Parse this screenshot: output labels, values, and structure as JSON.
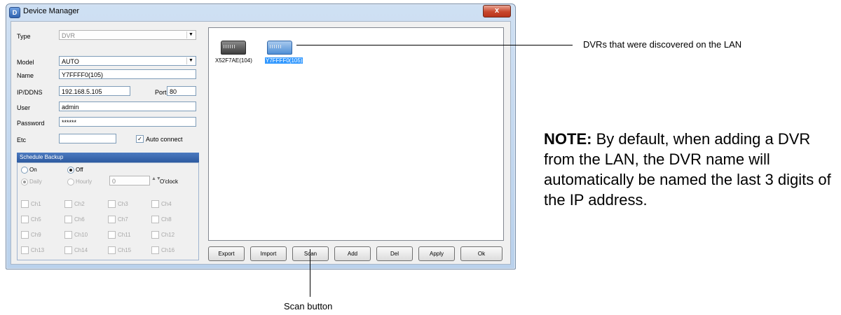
{
  "window": {
    "title": "Device Manager",
    "close_glyph": "x"
  },
  "form": {
    "type_label": "Type",
    "type_value": "DVR",
    "model_label": "Model",
    "model_value": "AUTO",
    "name_label": "Name",
    "name_value": "Y7FFFF0(105)",
    "ip_label": "IP/DDNS",
    "ip_value": "192.168.5.105",
    "port_label": "Port",
    "port_value": "80",
    "user_label": "User",
    "user_value": "admin",
    "password_label": "Password",
    "password_value": "******",
    "etc_label": "Etc",
    "etc_value": "",
    "auto_connect_label": "Auto connect",
    "auto_connect_checked": true
  },
  "schedule": {
    "header": "Schedule Backup",
    "on_label": "On",
    "off_label": "Off",
    "selected": "Off",
    "daily_label": "Daily",
    "hourly_label": "Hourly",
    "hour_value": "0",
    "oclock_label": "O'clock",
    "channels": [
      "Ch1",
      "Ch2",
      "Ch3",
      "Ch4",
      "Ch5",
      "Ch6",
      "Ch7",
      "Ch8",
      "Ch9",
      "Ch10",
      "Ch11",
      "Ch12",
      "Ch13",
      "Ch14",
      "Ch15",
      "Ch16"
    ]
  },
  "devices": [
    {
      "name": "X52F7AE(104)",
      "selected": false,
      "icon": "dvr-device-icon"
    },
    {
      "name": "Y7FFFF0(105)",
      "selected": true,
      "icon": "dvr-device-icon"
    }
  ],
  "buttons": {
    "export": "Export",
    "import": "Import",
    "scan": "Scan",
    "add": "Add",
    "del": "Del",
    "apply": "Apply",
    "ok": "Ok"
  },
  "callouts": {
    "devices": "DVRs that were discovered on the LAN",
    "scan": "Scan button"
  },
  "note": {
    "label": "NOTE:",
    "text": " By default, when adding a DVR from the LAN, the DVR name will automatically be named the last 3 digits of the IP address."
  }
}
